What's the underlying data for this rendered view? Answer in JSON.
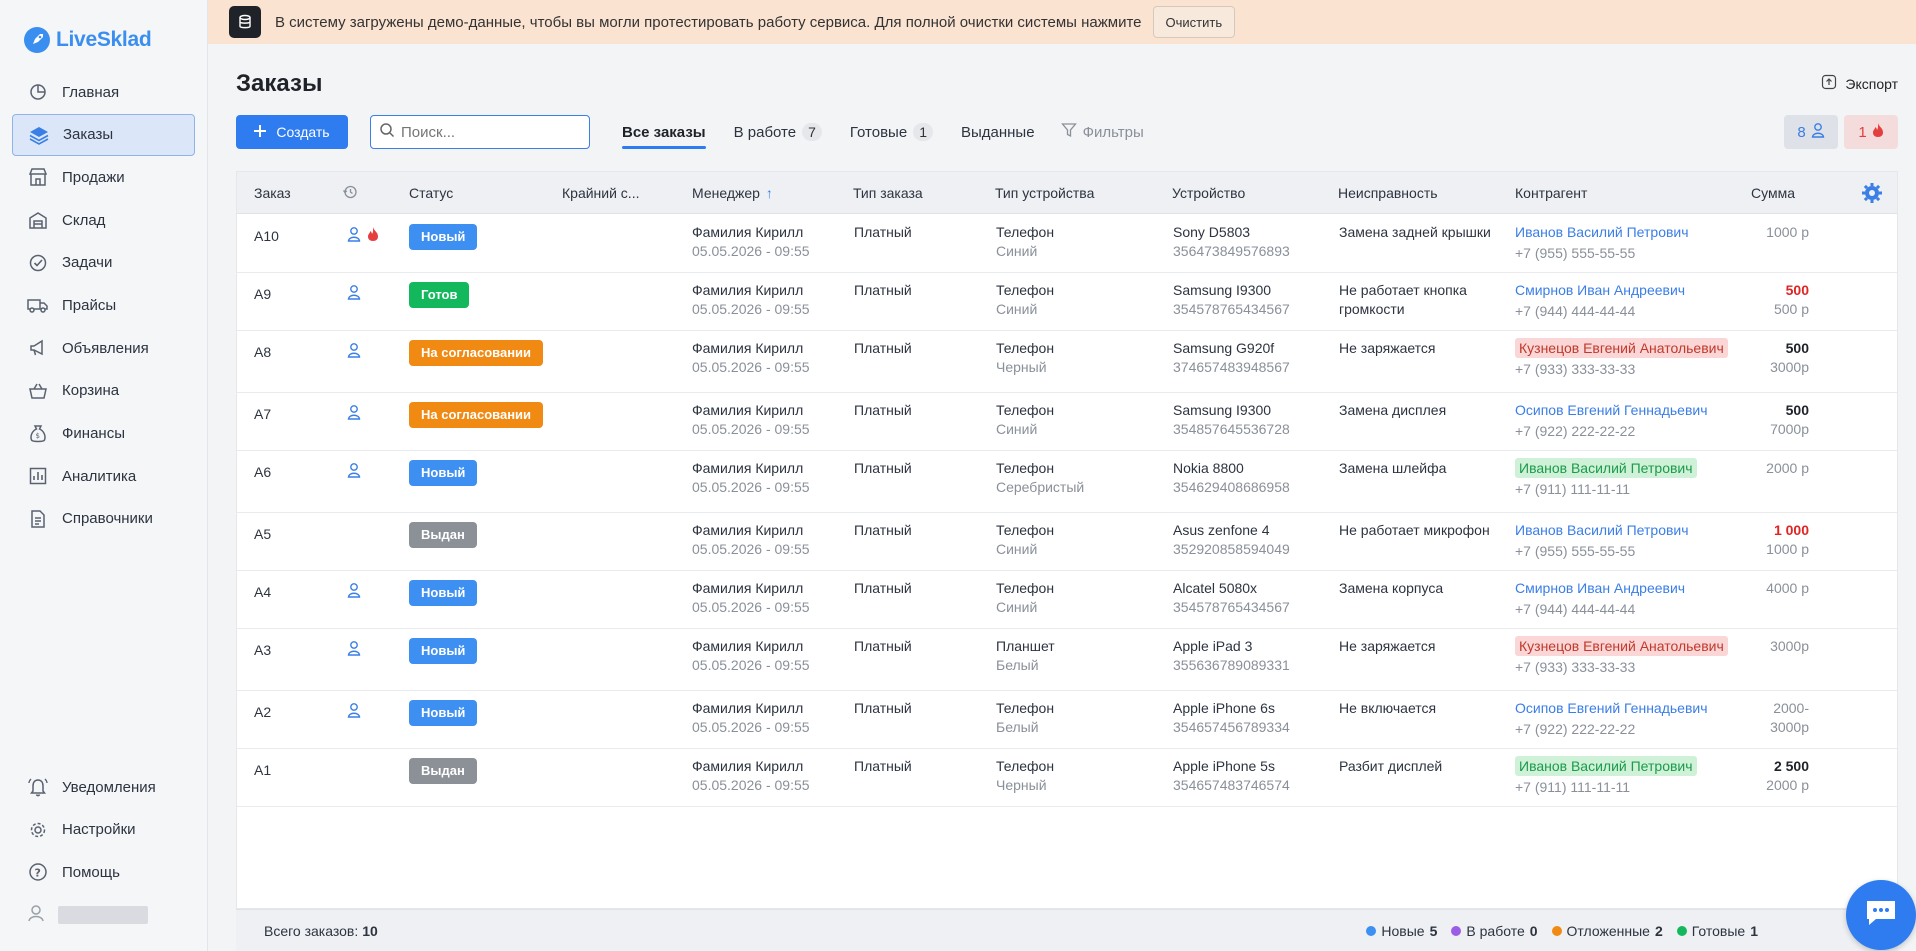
{
  "app": {
    "name": "LiveSklad"
  },
  "sidebar": {
    "items": [
      {
        "label": "Главная",
        "icon": "pie-chart-icon"
      },
      {
        "label": "Заказы",
        "icon": "layers-icon",
        "active": true
      },
      {
        "label": "Продажи",
        "icon": "shop-icon"
      },
      {
        "label": "Склад",
        "icon": "warehouse-icon"
      },
      {
        "label": "Задачи",
        "icon": "check-circle-icon"
      },
      {
        "label": "Прайсы",
        "icon": "truck-icon"
      },
      {
        "label": "Объявления",
        "icon": "megaphone-icon"
      },
      {
        "label": "Корзина",
        "icon": "basket-icon"
      },
      {
        "label": "Финансы",
        "icon": "money-bag-icon"
      },
      {
        "label": "Аналитика",
        "icon": "analytics-icon"
      },
      {
        "label": "Справочники",
        "icon": "document-icon"
      }
    ],
    "bottom": [
      {
        "label": "Уведомления",
        "icon": "bell-icon"
      },
      {
        "label": "Настройки",
        "icon": "gear-icon"
      },
      {
        "label": "Помощь",
        "icon": "help-icon"
      }
    ]
  },
  "banner": {
    "text": "В систему загружены демо-данные, чтобы вы могли протестировать работу сервиса. Для полной очистки системы нажмите",
    "button": "Очистить"
  },
  "page": {
    "title": "Заказы",
    "export": "Экспорт"
  },
  "toolbar": {
    "create": "Создать",
    "search_placeholder": "Поиск...",
    "tabs": [
      {
        "label": "Все заказы",
        "active": true
      },
      {
        "label": "В работе",
        "count": "7"
      },
      {
        "label": "Готовые",
        "count": "1"
      },
      {
        "label": "Выданные"
      }
    ],
    "filters": "Фильтры",
    "pill_users": "8",
    "pill_fire": "1"
  },
  "table": {
    "columns": [
      "Заказ",
      "Статус",
      "Крайний с...",
      "Менеджер",
      "Тип заказа",
      "Тип устройства",
      "Устройство",
      "Неисправность",
      "Контрагент",
      "Сумма"
    ],
    "rows": [
      {
        "id": "A10",
        "icons": [
          "user",
          "fire"
        ],
        "status": "Новый",
        "status_color": "blue",
        "manager": "Фамилия Кирилл",
        "date": "05.05.2026 - 09:55",
        "type": "Платный",
        "device_type": "Телефон",
        "color": "Синий",
        "device": "Sony D5803",
        "serial": "356473849576893",
        "issue": "Замена задней крышки",
        "issue2": "",
        "client": "Иванов Василий Петрович",
        "client_style": "link",
        "phone": "+7 (955) 555-55-55",
        "sum": "1000 р",
        "sum2": ""
      },
      {
        "id": "A9",
        "icons": [
          "user"
        ],
        "status": "Готов",
        "status_color": "green",
        "manager": "Фамилия Кирилл",
        "date": "05.05.2026 - 09:55",
        "type": "Платный",
        "device_type": "Телефон",
        "color": "Синий",
        "device": "Samsung I9300",
        "serial": "354578765434567",
        "issue": "Не работает кнопка",
        "issue2": "громкости",
        "client": "Смирнов Иван Андреевич",
        "client_style": "link",
        "phone": "+7 (944) 444-44-44",
        "sum": "500",
        "sum_style": "red",
        "sum2": "500 р"
      },
      {
        "id": "A8",
        "icons": [
          "user"
        ],
        "status": "На согласовании",
        "status_color": "orange",
        "manager": "Фамилия Кирилл",
        "date": "05.05.2026 - 09:55",
        "type": "Платный",
        "device_type": "Телефон",
        "color": "Черный",
        "device": "Samsung G920f",
        "serial": "374657483948567",
        "issue": "Не заряжается",
        "issue2": "",
        "client": "Кузнецов Евгений Анатольевич",
        "client_style": "red",
        "phone": "+7 (933) 333-33-33",
        "sum": "500",
        "sum_style": "strong",
        "sum2": "3000р"
      },
      {
        "id": "A7",
        "icons": [
          "user"
        ],
        "status": "На согласовании",
        "status_color": "orange",
        "manager": "Фамилия Кирилл",
        "date": "05.05.2026 - 09:55",
        "type": "Платный",
        "device_type": "Телефон",
        "color": "Синий",
        "device": "Samsung I9300",
        "serial": "354857645536728",
        "issue": "Замена дисплея",
        "issue2": "",
        "client": "Осипов Евгений Геннадьевич",
        "client_style": "link",
        "phone": "+7 (922) 222-22-22",
        "sum": "500",
        "sum_style": "strong",
        "sum2": "7000р"
      },
      {
        "id": "A6",
        "icons": [
          "user"
        ],
        "status": "Новый",
        "status_color": "blue",
        "manager": "Фамилия Кирилл",
        "date": "05.05.2026 - 09:55",
        "type": "Платный",
        "device_type": "Телефон",
        "color": "Серебристый",
        "device": "Nokia 8800",
        "serial": "354629408686958",
        "issue": "Замена шлейфа",
        "issue2": "",
        "client": "Иванов Василий Петрович",
        "client_style": "green",
        "phone": "+7 (911) 111-11-11",
        "sum": "2000 р",
        "sum2": ""
      },
      {
        "id": "A5",
        "icons": [],
        "status": "Выдан",
        "status_color": "gray",
        "manager": "Фамилия Кирилл",
        "date": "05.05.2026 - 09:55",
        "type": "Платный",
        "device_type": "Телефон",
        "color": "Синий",
        "device": "Asus zenfone 4",
        "serial": "352920858594049",
        "issue": "Не работает микрофон",
        "issue2": "",
        "client": "Иванов Василий Петрович",
        "client_style": "link",
        "phone": "+7 (955) 555-55-55",
        "sum": "1 000",
        "sum_style": "red",
        "sum2": "1000 р"
      },
      {
        "id": "A4",
        "icons": [
          "user"
        ],
        "status": "Новый",
        "status_color": "blue",
        "manager": "Фамилия Кирилл",
        "date": "05.05.2026 - 09:55",
        "type": "Платный",
        "device_type": "Телефон",
        "color": "Синий",
        "device": "Alcatel 5080x",
        "serial": "354578765434567",
        "issue": "Замена корпуса",
        "issue2": "",
        "client": "Смирнов Иван Андреевич",
        "client_style": "link",
        "phone": "+7 (944) 444-44-44",
        "sum": "4000 р",
        "sum2": ""
      },
      {
        "id": "A3",
        "icons": [
          "user"
        ],
        "status": "Новый",
        "status_color": "blue",
        "manager": "Фамилия Кирилл",
        "date": "05.05.2026 - 09:55",
        "type": "Платный",
        "device_type": "Планшет",
        "color": "Белый",
        "device": "Apple iPad 3",
        "serial": "355636789089331",
        "issue": "Не заряжается",
        "issue2": "",
        "client": "Кузнецов Евгений Анатольевич",
        "client_style": "red",
        "phone": "+7 (933) 333-33-33",
        "sum": "3000р",
        "sum2": ""
      },
      {
        "id": "A2",
        "icons": [
          "user"
        ],
        "status": "Новый",
        "status_color": "blue",
        "manager": "Фамилия Кирилл",
        "date": "05.05.2026 - 09:55",
        "type": "Платный",
        "device_type": "Телефон",
        "color": "Белый",
        "device": "Apple iPhone 6s",
        "serial": "354657456789334",
        "issue": "Не включается",
        "issue2": "",
        "client": "Осипов Евгений Геннадьевич",
        "client_style": "link",
        "phone": "+7 (922) 222-22-22",
        "sum": "2000-",
        "sum2": "3000р"
      },
      {
        "id": "A1",
        "icons": [],
        "status": "Выдан",
        "status_color": "gray",
        "manager": "Фамилия Кирилл",
        "date": "05.05.2026 - 09:55",
        "type": "Платный",
        "device_type": "Телефон",
        "color": "Черный",
        "device": "Apple iPhone 5s",
        "serial": "354657483746574",
        "issue": "Разбит дисплей",
        "issue2": "",
        "client": "Иванов Василий Петрович",
        "client_style": "green",
        "phone": "+7 (911) 111-11-11",
        "sum": "2 500",
        "sum_style": "strong",
        "sum2": "2000 р"
      }
    ]
  },
  "footer": {
    "total_label": "Всего заказов:",
    "total": "10",
    "legend": [
      {
        "label": "Новые",
        "count": "5",
        "color": "#3d8ff2"
      },
      {
        "label": "В работе",
        "count": "0",
        "color": "#9b5de5"
      },
      {
        "label": "Отложенные",
        "count": "2",
        "color": "#f08a13"
      },
      {
        "label": "Готовые",
        "count": "1",
        "color": "#14b85c"
      }
    ]
  }
}
